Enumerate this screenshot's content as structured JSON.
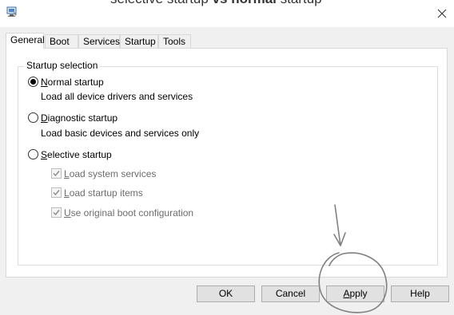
{
  "window": {
    "ghost_title_prefix": "selective startup ",
    "ghost_title_bold1": "vs",
    "ghost_title_mid": " ",
    "ghost_title_bold2": "normal",
    "ghost_title_suffix": " startup"
  },
  "tabs": [
    {
      "label": "General",
      "active": true
    },
    {
      "label": "Boot"
    },
    {
      "label": "Services"
    },
    {
      "label": "Startup"
    },
    {
      "label": "Tools"
    }
  ],
  "startup_selection": {
    "legend": "Startup selection",
    "normal": {
      "key": "N",
      "rest": "ormal startup",
      "desc": "Load all device drivers and services",
      "selected": true
    },
    "diagnostic": {
      "key": "D",
      "rest": "iagnostic startup",
      "desc": "Load basic devices and services only",
      "selected": false
    },
    "selective": {
      "key": "S",
      "rest": "elective startup",
      "selected": false
    },
    "checks": [
      {
        "key": "L",
        "rest": "oad system services",
        "checked": true,
        "disabled": true
      },
      {
        "key": "L",
        "rest": "oad startup items",
        "checked": true,
        "disabled": true
      },
      {
        "key": "U",
        "rest": "se original boot configuration",
        "checked": true,
        "disabled": true
      }
    ]
  },
  "buttons": {
    "ok": "OK",
    "cancel": "Cancel",
    "apply_key": "A",
    "apply_rest": "pply",
    "help": "Help"
  },
  "annotation": {
    "sketch_color": "#808080"
  },
  "colors": {
    "tab_active_bg": "#ffffff",
    "dialog_bg": "#f0f0f0",
    "button_bg": "#e1e1e1"
  }
}
